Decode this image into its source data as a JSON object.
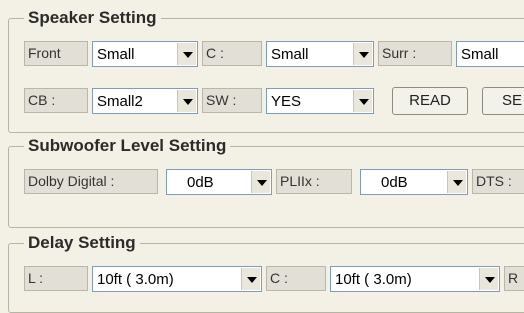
{
  "speaker_setting": {
    "title": "Speaker Setting",
    "front": {
      "label": "Front",
      "value": "Small"
    },
    "center": {
      "label": "C :",
      "value": "Small"
    },
    "surround": {
      "label": "Surr :",
      "value": "Small"
    },
    "cb": {
      "label": "CB :",
      "value": "Small2"
    },
    "sw": {
      "label": "SW :",
      "value": "YES"
    },
    "read_button": "READ",
    "se_button": "SE"
  },
  "subwoofer_level_setting": {
    "title": "Subwoofer Level Setting",
    "dolby_digital": {
      "label": "Dolby Digital :",
      "value": "0dB"
    },
    "pliix": {
      "label": "PLIIx :",
      "value": "0dB"
    },
    "dts": {
      "label": "DTS :"
    }
  },
  "delay_setting": {
    "title": "Delay Setting",
    "l": {
      "label": "L :",
      "value": "10ft ( 3.0m)"
    },
    "c": {
      "label": "C :",
      "value": "10ft ( 3.0m)"
    },
    "r": {
      "label": "R"
    }
  }
}
